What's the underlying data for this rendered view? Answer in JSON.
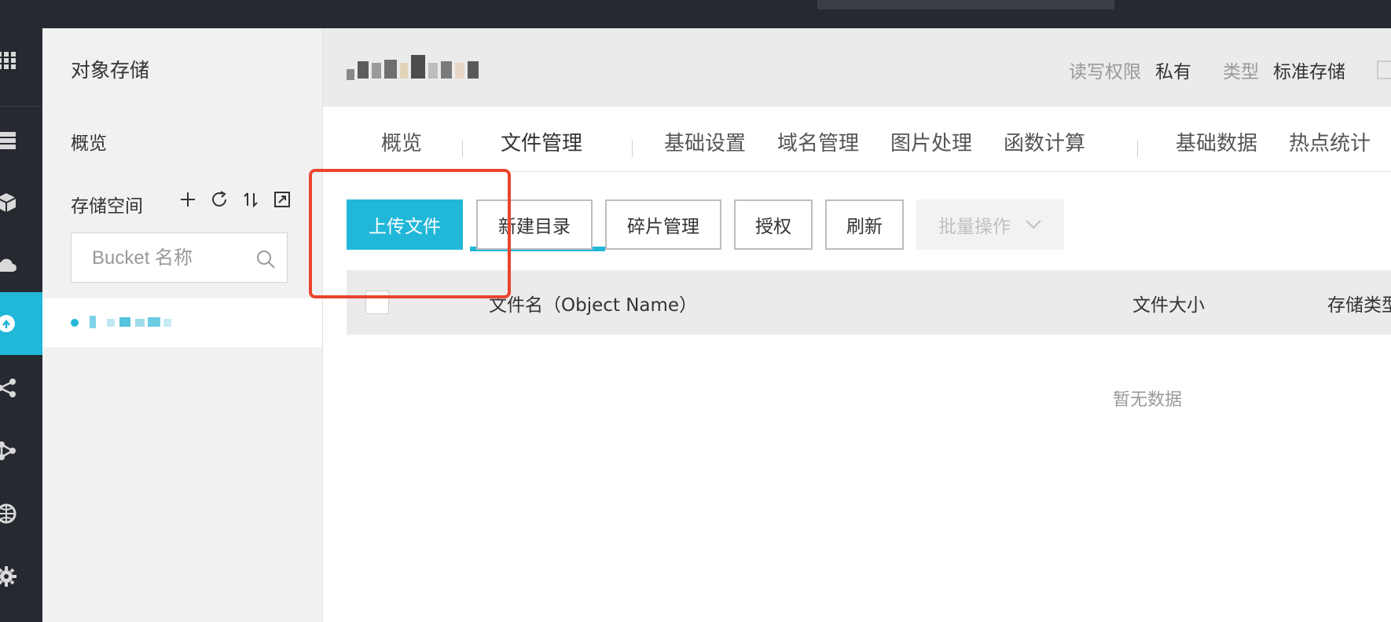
{
  "sidebar": {
    "title": "对象存储",
    "overview": "概览",
    "storage_space": "存储空间",
    "search_placeholder": "Bucket 名称",
    "tools": [
      "plus-icon",
      "refresh-icon",
      "sort-icon",
      "expand-icon"
    ]
  },
  "rail_icons": [
    "apps-grid-icon",
    "server-icon",
    "package-icon",
    "cloud-icon",
    "oss-icon",
    "share-icon",
    "network-icon",
    "globe-icon",
    "settings-gear-icon"
  ],
  "header": {
    "meta": [
      {
        "key": "读写权限",
        "value": "私有"
      },
      {
        "key": "类型",
        "value": "标准存储"
      }
    ]
  },
  "tabs": [
    "概览",
    "文件管理",
    "基础设置",
    "域名管理",
    "图片处理",
    "函数计算",
    "基础数据",
    "热点统计"
  ],
  "active_tab": "文件管理",
  "toolbar": {
    "upload": "上传文件",
    "new_dir": "新建目录",
    "fragments": "碎片管理",
    "authorize": "授权",
    "refresh": "刷新",
    "batch": "批量操作"
  },
  "table": {
    "columns": [
      "文件名（Object Name）",
      "文件大小",
      "存储类型"
    ],
    "empty_text": "暂无数据"
  },
  "colors": {
    "accent": "#21b7d8",
    "annotation": "#e9452d",
    "dark_rail": "#262a30"
  }
}
